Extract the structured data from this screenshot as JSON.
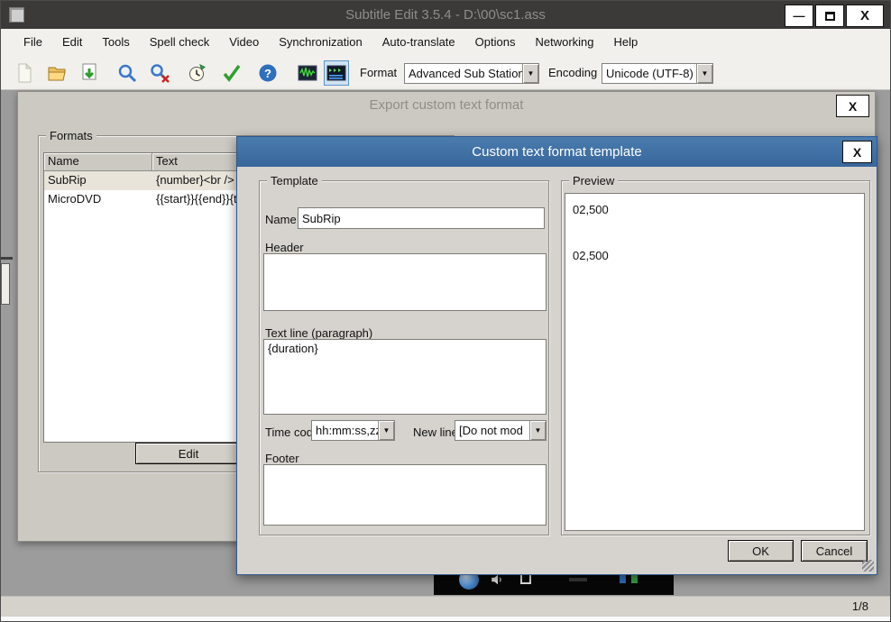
{
  "colors": {
    "titlebar": "#3b3a39",
    "active_dialog_title": "#3a6da4",
    "dialog_bg": "#d6d3ce",
    "dimmed_bg": "#9c9c9c",
    "selection_row": "#e9e4da"
  },
  "window": {
    "title": "Subtitle Edit 3.5.4 - D:\\00\\sc1.ass",
    "minimize_glyph": "—",
    "close_glyph": "X"
  },
  "menu": {
    "items": [
      "File",
      "Edit",
      "Tools",
      "Spell check",
      "Video",
      "Synchronization",
      "Auto-translate",
      "Options",
      "Networking",
      "Help"
    ]
  },
  "toolbar": {
    "icons": [
      "new-file-icon",
      "open-folder-icon",
      "save-icon",
      "find-icon",
      "replace-icon",
      "visual-sync-icon",
      "spell-check-icon",
      "help-icon",
      "waveform-toggle-icon",
      "video-list-toggle-icon"
    ],
    "format_label": "Format",
    "format_value": "Advanced Sub Station",
    "encoding_label": "Encoding",
    "encoding_value": "Unicode (UTF-8)"
  },
  "icons": {
    "combo_arrow": "▼"
  },
  "export_dialog": {
    "title": "Export custom text format",
    "close_glyph": "X",
    "group_label": "Formats",
    "columns": [
      "Name",
      "Text"
    ],
    "rows": [
      {
        "name": "SubRip",
        "text": "{number}<br />"
      },
      {
        "name": "MicroDVD",
        "text": "{{start}}{{end}}{t"
      }
    ],
    "edit_button": "Edit"
  },
  "template_dialog": {
    "title": "Custom text format template",
    "close_glyph": "X",
    "group_label": "Template",
    "name_label": "Name",
    "name_value": "SubRip",
    "header_label": "Header",
    "header_value": "",
    "paragraph_label": "Text line (paragraph)",
    "paragraph_value": "{duration}",
    "timecode_label": "Time code",
    "timecode_value": "hh:mm:ss,zz",
    "newline_label": "New line",
    "newline_value": "[Do not mod",
    "footer_label": "Footer",
    "footer_value": "",
    "preview_label": "Preview",
    "preview_lines": [
      "02,500",
      "02,500"
    ],
    "ok_button": "OK",
    "cancel_button": "Cancel"
  },
  "status": {
    "page_indicator": "1/8"
  }
}
